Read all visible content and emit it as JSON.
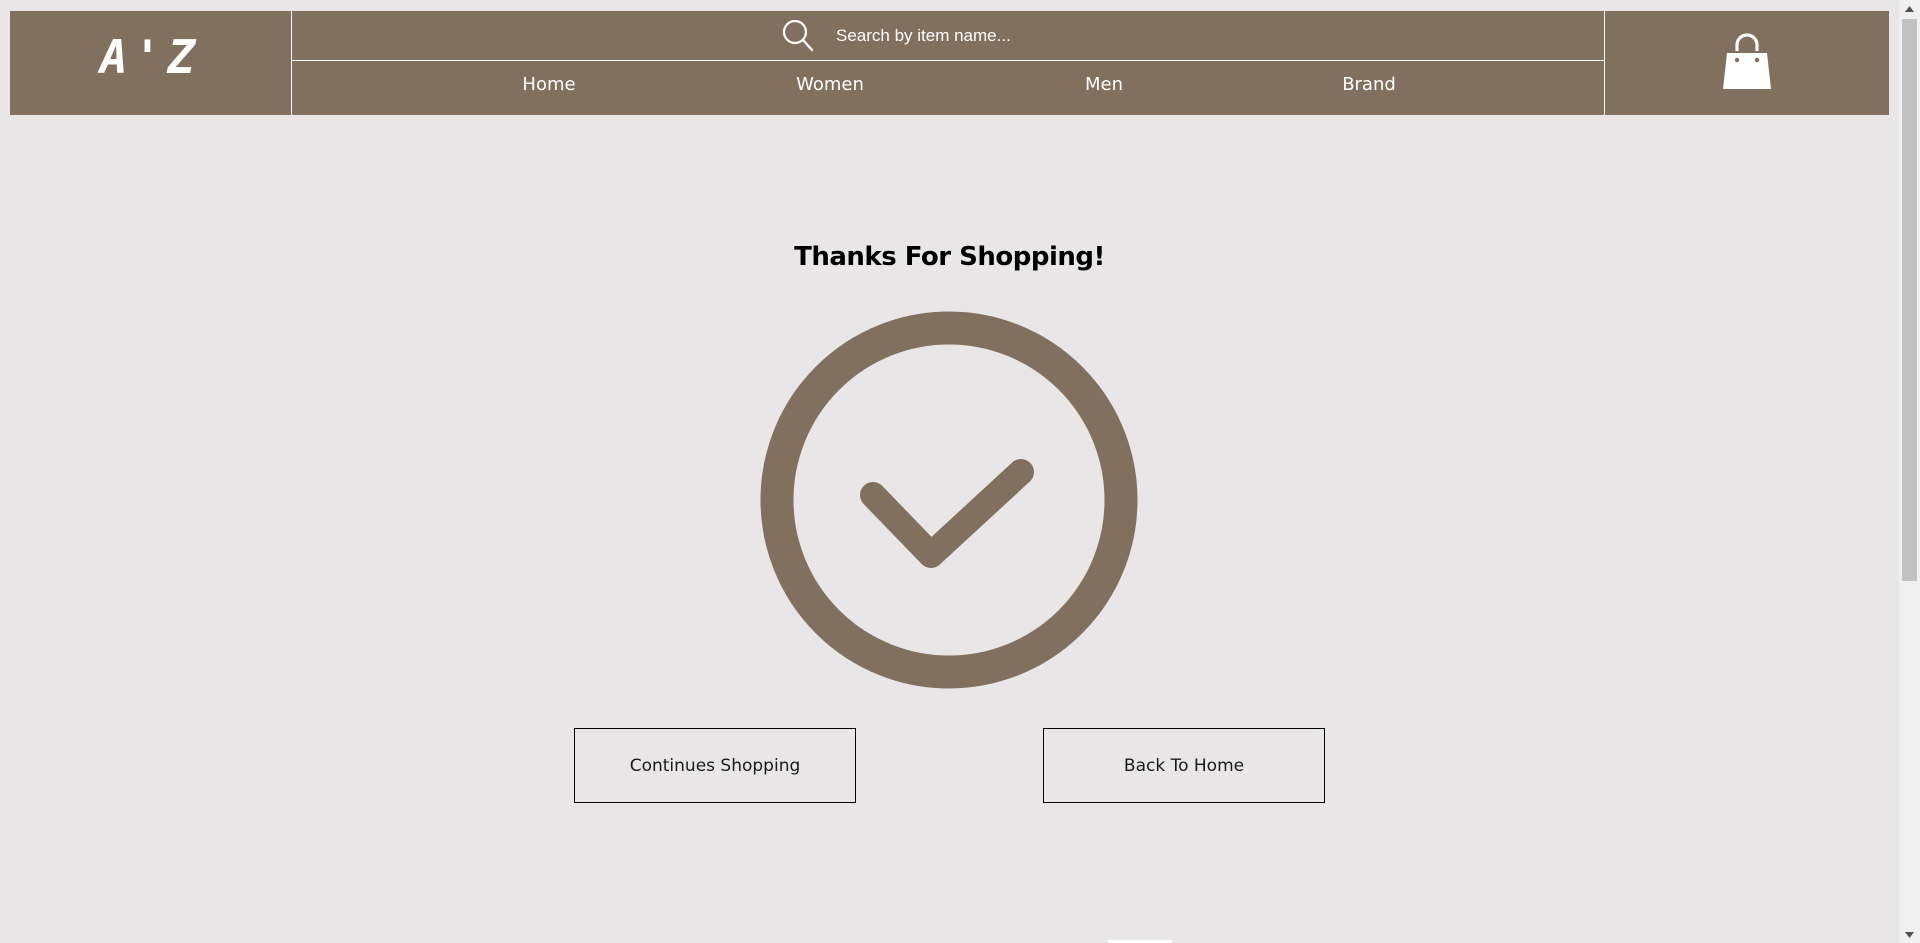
{
  "header": {
    "logo_text": "A'Z",
    "search": {
      "placeholder": "Search by item name...",
      "icon": "search-icon"
    },
    "nav": [
      {
        "label": "Home"
      },
      {
        "label": "Women"
      },
      {
        "label": "Men"
      },
      {
        "label": "Brand"
      }
    ],
    "cart_icon": "shopping-bag-icon"
  },
  "main": {
    "title": "Thanks For Shopping!",
    "success_icon": "check-circle-icon",
    "buttons": {
      "continue_label": "Continues Shopping",
      "home_label": "Back To Home"
    }
  },
  "colors": {
    "brand": "#82705f",
    "background": "#e8e6e7",
    "text": "#000000",
    "header_text": "#ffffff"
  }
}
